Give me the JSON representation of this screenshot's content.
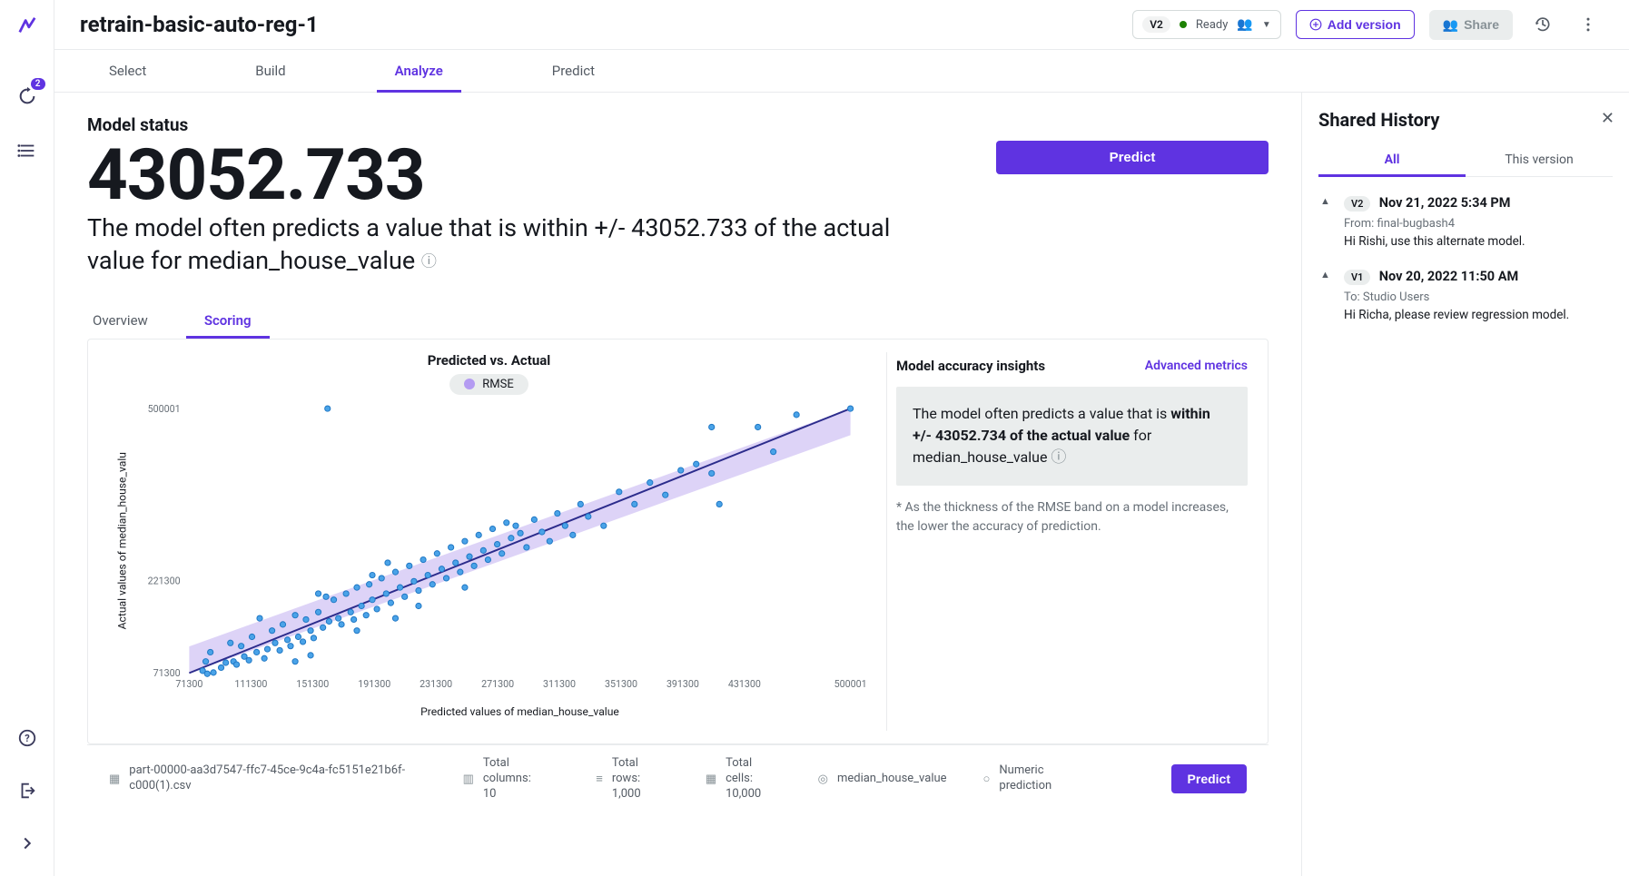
{
  "header": {
    "title": "retrain-basic-auto-reg-1",
    "version_label": "V2",
    "status": "Ready",
    "add_version": "Add version",
    "share": "Share"
  },
  "tabs": [
    "Select",
    "Build",
    "Analyze",
    "Predict"
  ],
  "active_tab": 2,
  "model_status": {
    "heading": "Model status",
    "metric": "43052.733",
    "description": "The model often predicts a value that is within +/- 43052.733 of the actual value for median_house_value",
    "predict_btn": "Predict"
  },
  "subtabs": [
    "Overview",
    "Scoring"
  ],
  "active_subtab": 1,
  "chart": {
    "title": "Predicted vs. Actual",
    "legend": "RMSE",
    "xlabel": "Predicted values of median_house_value",
    "ylabel": "Actual values of median_house_valu"
  },
  "chart_data": {
    "type": "scatter",
    "xlim": [
      71300,
      500001
    ],
    "ylim": [
      71300,
      500001
    ],
    "xticks": [
      71300,
      111300,
      151300,
      191300,
      231300,
      271300,
      311300,
      351300,
      391300,
      431300,
      500001
    ],
    "yticks": [
      71300,
      221300,
      500001
    ],
    "fit_line": [
      [
        71300,
        71300
      ],
      [
        500001,
        500001
      ]
    ],
    "rmse_band": 43052.734,
    "xlabel": "Predicted values of median_house_value",
    "ylabel": "Actual values of median_house_valu",
    "points": [
      [
        80000,
        75000
      ],
      [
        82000,
        90000
      ],
      [
        83000,
        70000
      ],
      [
        85000,
        105000
      ],
      [
        87000,
        72000
      ],
      [
        92000,
        80000
      ],
      [
        95000,
        88000
      ],
      [
        98000,
        120000
      ],
      [
        100000,
        90000
      ],
      [
        102000,
        85000
      ],
      [
        105000,
        115000
      ],
      [
        107000,
        98000
      ],
      [
        110000,
        92000
      ],
      [
        112000,
        130000
      ],
      [
        115000,
        105000
      ],
      [
        117000,
        160000
      ],
      [
        120000,
        95000
      ],
      [
        122000,
        110000
      ],
      [
        125000,
        140000
      ],
      [
        127000,
        120000
      ],
      [
        130000,
        108000
      ],
      [
        132000,
        150000
      ],
      [
        135000,
        125000
      ],
      [
        137000,
        115000
      ],
      [
        140000,
        165000
      ],
      [
        142000,
        130000
      ],
      [
        145000,
        122000
      ],
      [
        147000,
        158000
      ],
      [
        150000,
        140000
      ],
      [
        152000,
        128000
      ],
      [
        155000,
        170000
      ],
      [
        158000,
        145000
      ],
      [
        161000,
        500001
      ],
      [
        162000,
        155000
      ],
      [
        165000,
        190000
      ],
      [
        168000,
        160000
      ],
      [
        170000,
        150000
      ],
      [
        173000,
        200000
      ],
      [
        176000,
        170000
      ],
      [
        178000,
        158000
      ],
      [
        180000,
        210000
      ],
      [
        183000,
        180000
      ],
      [
        186000,
        165000
      ],
      [
        188000,
        215000
      ],
      [
        190000,
        190000
      ],
      [
        193000,
        175000
      ],
      [
        196000,
        225000
      ],
      [
        199000,
        200000
      ],
      [
        202000,
        185000
      ],
      [
        205000,
        235000
      ],
      [
        208000,
        210000
      ],
      [
        211000,
        195000
      ],
      [
        214000,
        245000
      ],
      [
        217000,
        220000
      ],
      [
        220000,
        205000
      ],
      [
        223000,
        255000
      ],
      [
        226000,
        230000
      ],
      [
        229000,
        215000
      ],
      [
        232000,
        265000
      ],
      [
        235000,
        240000
      ],
      [
        238000,
        225000
      ],
      [
        241000,
        275000
      ],
      [
        244000,
        250000
      ],
      [
        247000,
        235000
      ],
      [
        250000,
        285000
      ],
      [
        253000,
        260000
      ],
      [
        256000,
        245000
      ],
      [
        259000,
        295000
      ],
      [
        262000,
        270000
      ],
      [
        265000,
        255000
      ],
      [
        268000,
        305000
      ],
      [
        271000,
        280000
      ],
      [
        274000,
        265000
      ],
      [
        277000,
        315000
      ],
      [
        280000,
        290000
      ],
      [
        283000,
        310000
      ],
      [
        286000,
        298000
      ],
      [
        290000,
        275000
      ],
      [
        295000,
        320000
      ],
      [
        300000,
        300000
      ],
      [
        305000,
        285000
      ],
      [
        310000,
        330000
      ],
      [
        315000,
        310000
      ],
      [
        320000,
        295000
      ],
      [
        325000,
        345000
      ],
      [
        330000,
        325000
      ],
      [
        340000,
        310000
      ],
      [
        350000,
        365000
      ],
      [
        360000,
        345000
      ],
      [
        370000,
        380000
      ],
      [
        380000,
        360000
      ],
      [
        390000,
        400000
      ],
      [
        400000,
        410000
      ],
      [
        410000,
        395000
      ],
      [
        410000,
        470000
      ],
      [
        415000,
        345000
      ],
      [
        440000,
        470000
      ],
      [
        450000,
        430000
      ],
      [
        465000,
        490000
      ],
      [
        500001,
        500001
      ],
      [
        150000,
        100000
      ],
      [
        220000,
        180000
      ],
      [
        155000,
        200000
      ],
      [
        190000,
        230000
      ],
      [
        250000,
        210000
      ],
      [
        200000,
        250000
      ],
      [
        140000,
        90000
      ],
      [
        180000,
        140000
      ],
      [
        160000,
        195000
      ],
      [
        205000,
        160000
      ]
    ]
  },
  "insights": {
    "heading": "Model accuracy insights",
    "advanced": "Advanced metrics",
    "text_pre": "The model often predicts a value that is ",
    "text_bold": "within +/- 43052.734 of the actual value",
    "text_post": " for median_house_value ",
    "footnote": "* As the thickness of the RMSE band on a model increases, the lower the accuracy of prediction."
  },
  "footer": {
    "filename": "part-00000-aa3d7547-ffc7-45ce-9c4a-fc5151e21b6f-c000(1).csv",
    "cols_label": "Total columns:",
    "cols_val": "10",
    "rows_label": "Total rows:",
    "rows_val": "1,000",
    "cells_label": "Total cells:",
    "cells_val": "10,000",
    "target": "median_house_value",
    "ptype": "Numeric prediction",
    "predict": "Predict"
  },
  "side": {
    "title": "Shared History",
    "tabs": [
      "All",
      "This version"
    ],
    "active": 0,
    "history": [
      {
        "ver": "V2",
        "date": "Nov 21, 2022 5:34 PM",
        "from": "From: final-bugbash4",
        "msg": "Hi Rishi, use this alternate model."
      },
      {
        "ver": "V1",
        "date": "Nov 20, 2022 11:50 AM",
        "from": "To: Studio Users",
        "msg": "Hi Richa, please review regression model."
      }
    ]
  },
  "rail": {
    "badge": "2"
  }
}
